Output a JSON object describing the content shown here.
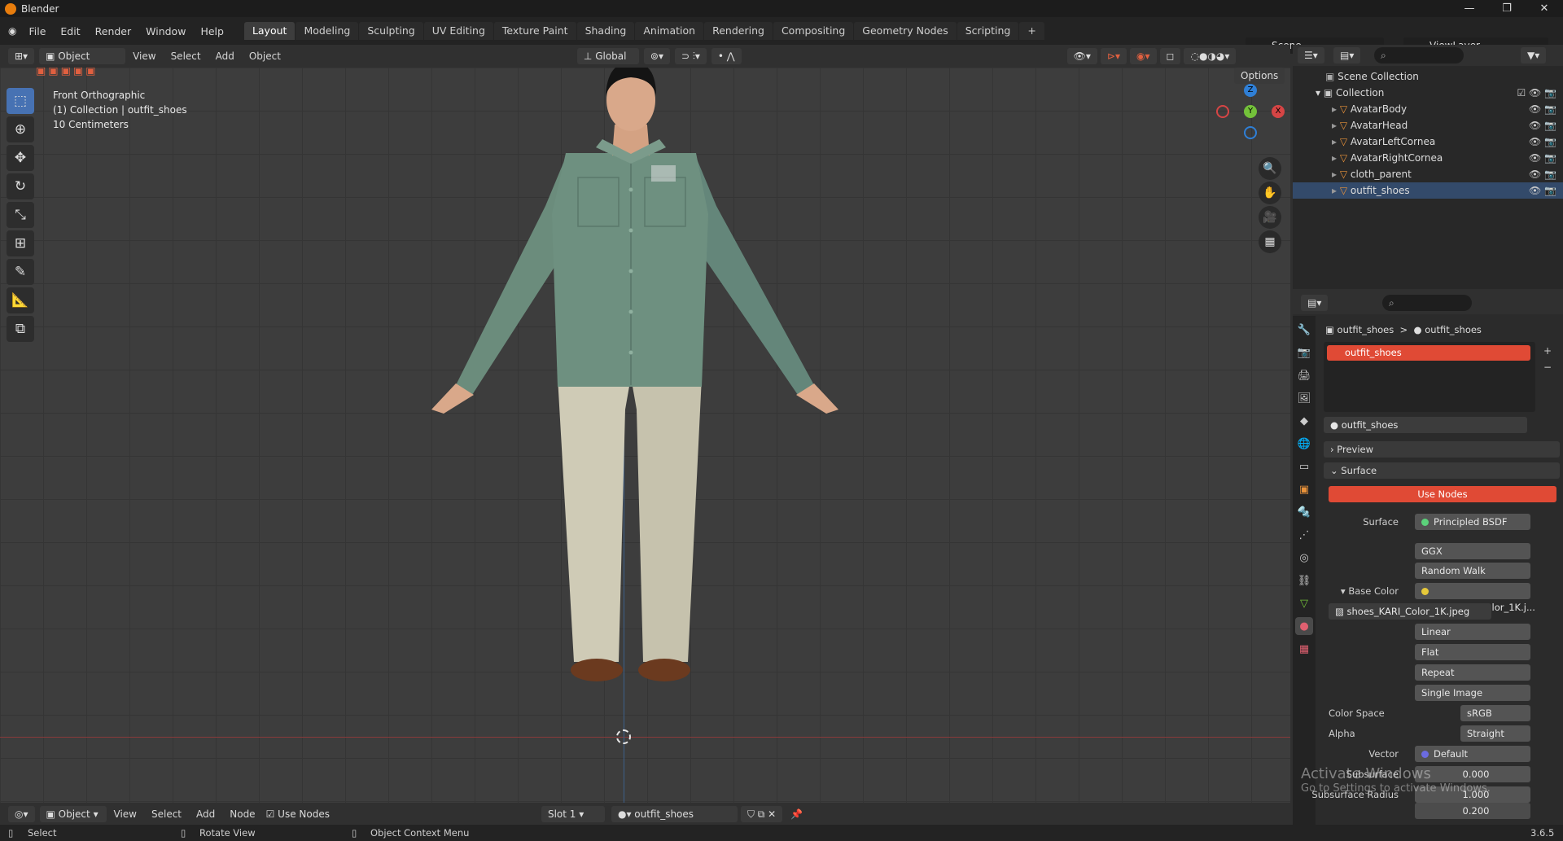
{
  "app": {
    "title": "Blender",
    "version": "3.6.5"
  },
  "menu": [
    "File",
    "Edit",
    "Render",
    "Window",
    "Help"
  ],
  "workspaces": [
    "Layout",
    "Modeling",
    "Sculpting",
    "UV Editing",
    "Texture Paint",
    "Shading",
    "Animation",
    "Rendering",
    "Compositing",
    "Geometry Nodes",
    "Scripting"
  ],
  "active_workspace": "Layout",
  "scene": "Scene",
  "view_layer": "ViewLayer",
  "viewport_header": {
    "mode": "Object Mode",
    "menus": [
      "View",
      "Select",
      "Add",
      "Object"
    ],
    "orientation": "Global",
    "options": "Options"
  },
  "viewport_info": {
    "line1": "Front Orthographic",
    "line2": "(1) Collection | outfit_shoes",
    "line3": "10 Centimeters"
  },
  "gizmo": {
    "z": "Z",
    "y": "Y",
    "x": "X"
  },
  "outliner": {
    "root": "Scene Collection",
    "collection": "Collection",
    "items": [
      "AvatarBody",
      "AvatarHead",
      "AvatarLeftCornea",
      "AvatarRightCornea",
      "cloth_parent",
      "outfit_shoes"
    ]
  },
  "properties": {
    "breadcrumb_object": "outfit_shoes",
    "breadcrumb_material": "outfit_shoes",
    "material_slot": "outfit_shoes",
    "material_name": "outfit_shoes",
    "preview": "Preview",
    "surface_panel": "Surface",
    "use_nodes": "Use Nodes",
    "surface_label": "Surface",
    "surface_value": "Principled BSDF",
    "distribution": "GGX",
    "subsurface_method": "Random Walk",
    "base_color_label": "Base Color",
    "base_color_value": "shoes_KARI_Color_1K.j...",
    "image_name": "shoes_KARI_Color_1K.jpeg",
    "interpolation": "Linear",
    "projection": "Flat",
    "extension": "Repeat",
    "source": "Single Image",
    "color_space_label": "Color Space",
    "color_space": "sRGB",
    "alpha_label": "Alpha",
    "alpha": "Straight",
    "vector_label": "Vector",
    "vector": "Default",
    "subsurface_label": "Subsurface",
    "subsurface": "0.000",
    "subsurface_radius_label": "Subsurface Radius",
    "radius1": "1.000",
    "radius2": "0.200"
  },
  "bottom_header": {
    "editor": "Object",
    "menus": [
      "View",
      "Select",
      "Add",
      "Node"
    ],
    "use_nodes": "Use Nodes",
    "slot": "Slot 1",
    "material": "outfit_shoes"
  },
  "statusbar": {
    "select": "Select",
    "rotate": "Rotate View",
    "context": "Object Context Menu"
  },
  "watermark": {
    "line1": "Activate Windows",
    "line2": "Go to Settings to activate Windows."
  },
  "colors": {
    "accent_red": "#c0392b",
    "active_blue": "#4772b3",
    "shirt": "#6b8c7c",
    "pants": "#c9c6b2",
    "shoes": "#6b3a1f"
  }
}
